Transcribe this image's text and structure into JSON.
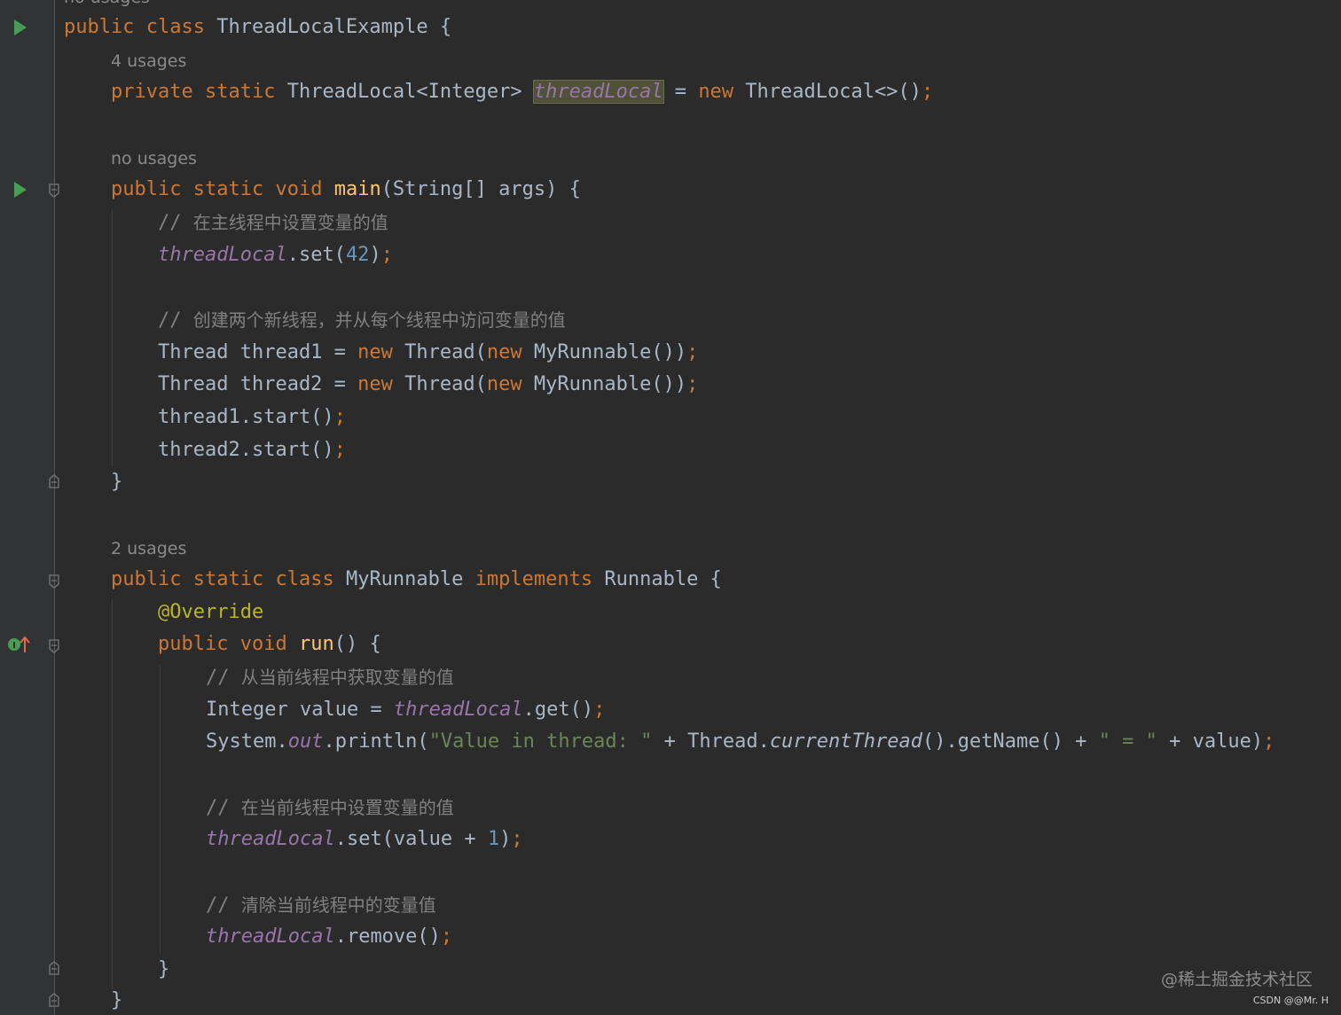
{
  "editor": {
    "top_cut_hint": "no usages",
    "class_decl": {
      "kw_public": "public",
      "kw_class": "class",
      "name": "ThreadLocalExample",
      "brace": " {"
    },
    "field_hint": "4 usages",
    "field_decl": {
      "kw_private": "private",
      "kw_static": "static",
      "type": "ThreadLocal<Integer>",
      "name": "threadLocal",
      "eq": " = ",
      "kw_new": "new",
      "ctor": " ThreadLocal<>()",
      "semi": ";"
    },
    "main_hint": "no usages",
    "main_decl": {
      "kw_public": "public",
      "kw_static": "static",
      "kw_void": "void",
      "name": "main",
      "params": "(String[] args) {"
    },
    "comment1": {
      "slashes": "// ",
      "text": "在主线程中设置变量的值"
    },
    "set_line": {
      "field": "threadLocal",
      "call": ".set(",
      "num": "42",
      "close": ")",
      "semi": ";"
    },
    "comment2": {
      "slashes": "// ",
      "text": "创建两个新线程，并从每个线程中访问变量的值"
    },
    "thread1_line": {
      "decl": "Thread thread1 = ",
      "kw_new1": "new",
      "mid": " Thread(",
      "kw_new2": "new",
      "tail": " MyRunnable())",
      "semi": ";"
    },
    "thread2_line": {
      "decl": "Thread thread2 = ",
      "kw_new1": "new",
      "mid": " Thread(",
      "kw_new2": "new",
      "tail": " MyRunnable())",
      "semi": ";"
    },
    "start1_line": {
      "code": "thread1.start()",
      "semi": ";"
    },
    "start2_line": {
      "code": "thread2.start()",
      "semi": ";"
    },
    "close_main": "}",
    "runnable_hint": "2 usages",
    "runnable_decl": {
      "kw_public": "public",
      "kw_static": "static",
      "kw_class": "class",
      "name": " MyRunnable ",
      "kw_impl": "implements",
      "iface": " Runnable {"
    },
    "override": "@Override",
    "run_decl": {
      "kw_public": "public",
      "kw_void": "void",
      "name": "run",
      "params": "() {"
    },
    "comment3": {
      "slashes": "// ",
      "text": "从当前线程中获取变量的值"
    },
    "get_line": {
      "decl": "Integer value = ",
      "field": "threadLocal",
      "call": ".get()",
      "semi": ";"
    },
    "println_line": {
      "sys": "System.",
      "out": "out",
      "pr": ".println(",
      "str1": "\"Value in thread: \"",
      "plus1": " + Thread.",
      "ct": "currentThread",
      "rest": "().getName() + ",
      "str2": "\" = \"",
      "end": " + value)",
      "semi": ";"
    },
    "comment4": {
      "slashes": "// ",
      "text": "在当前线程中设置变量的值"
    },
    "set2_line": {
      "field": "threadLocal",
      "call": ".set(value + ",
      "num": "1",
      "close": ")",
      "semi": ";"
    },
    "comment5": {
      "slashes": "// ",
      "text": "清除当前线程中的变量值"
    },
    "remove_line": {
      "field": "threadLocal",
      "call": ".remove()",
      "semi": ";"
    },
    "close_run": "}",
    "close_class": "}"
  },
  "watermark": "@稀土掘金技术社区",
  "credit": "CSDN @@Mr. H",
  "colors": {
    "background": "#2b2b2b",
    "gutter": "#313335",
    "keyword": "#cc7832",
    "method": "#ffc66d",
    "field": "#9876aa",
    "number": "#6897bb",
    "string": "#6a8759",
    "annotation": "#bbb529",
    "comment": "#808080",
    "text": "#a9b7c6",
    "run_icon": "#499c54"
  },
  "icons": [
    "run-icon",
    "fold-icon",
    "implements-icon"
  ]
}
